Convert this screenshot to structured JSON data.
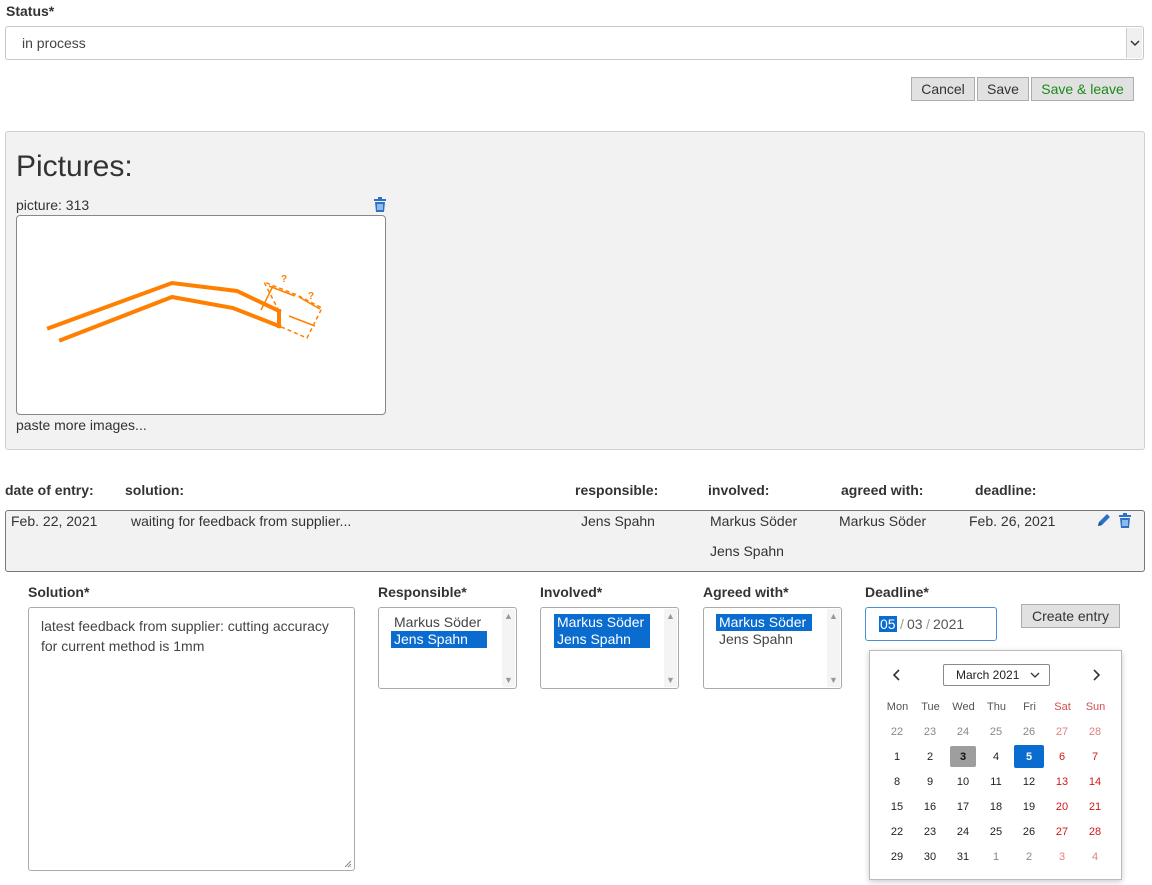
{
  "status": {
    "label": "Status*",
    "value": "in process"
  },
  "actions": {
    "cancel": "Cancel",
    "save": "Save",
    "save_leave": "Save & leave"
  },
  "pictures": {
    "title": "Pictures:",
    "items": [
      {
        "label": "picture: 313"
      }
    ],
    "paste_more": "paste more images...",
    "sketch_marks": [
      "?",
      "?"
    ]
  },
  "table": {
    "headers": {
      "date": "date of entry:",
      "solution": "solution:",
      "responsible": "responsible:",
      "involved": "involved:",
      "agreed": "agreed with:",
      "deadline": "deadline:"
    },
    "rows": [
      {
        "date": "Feb. 22, 2021",
        "solution": "waiting for feedback from supplier...",
        "responsible": "Jens Spahn",
        "involved": [
          "Markus Söder",
          "Jens Spahn"
        ],
        "agreed": "Markus Söder",
        "deadline": "Feb. 26, 2021"
      }
    ]
  },
  "form": {
    "solution_label": "Solution*",
    "solution_text": [
      "latest feedback from supplier: cutting accuracy",
      "for current method is 1mm"
    ],
    "responsible_label": "Responsible*",
    "responsible_options": [
      "Markus Söder",
      "Jens Spahn"
    ],
    "involved_label": "Involved*",
    "involved_options": [
      "Markus Söder",
      "Jens Spahn"
    ],
    "agreed_label": "Agreed with*",
    "agreed_options": [
      "Markus Söder",
      "Jens Spahn"
    ],
    "deadline_label": "Deadline*",
    "deadline": {
      "day": "05",
      "month": "03",
      "year": "2021",
      "sep": "/"
    },
    "create_label": "Create entry"
  },
  "calendar": {
    "month_label": "March 2021",
    "dow": [
      "Mon",
      "Tue",
      "Wed",
      "Thu",
      "Fri",
      "Sat",
      "Sun"
    ],
    "weeks": [
      [
        "22",
        "23",
        "24",
        "25",
        "26",
        "27",
        "28"
      ],
      [
        "1",
        "2",
        "3",
        "4",
        "5",
        "6",
        "7"
      ],
      [
        "8",
        "9",
        "10",
        "11",
        "12",
        "13",
        "14"
      ],
      [
        "15",
        "16",
        "17",
        "18",
        "19",
        "20",
        "21"
      ],
      [
        "22",
        "23",
        "24",
        "25",
        "26",
        "27",
        "28"
      ],
      [
        "29",
        "30",
        "31",
        "1",
        "2",
        "3",
        "4"
      ]
    ],
    "today": "3",
    "selected": "5"
  },
  "colors": {
    "accent": "#0a6ccf",
    "sketch": "#ff8000",
    "save_leave": "#1a8a1a",
    "weekend": "#d01818"
  }
}
